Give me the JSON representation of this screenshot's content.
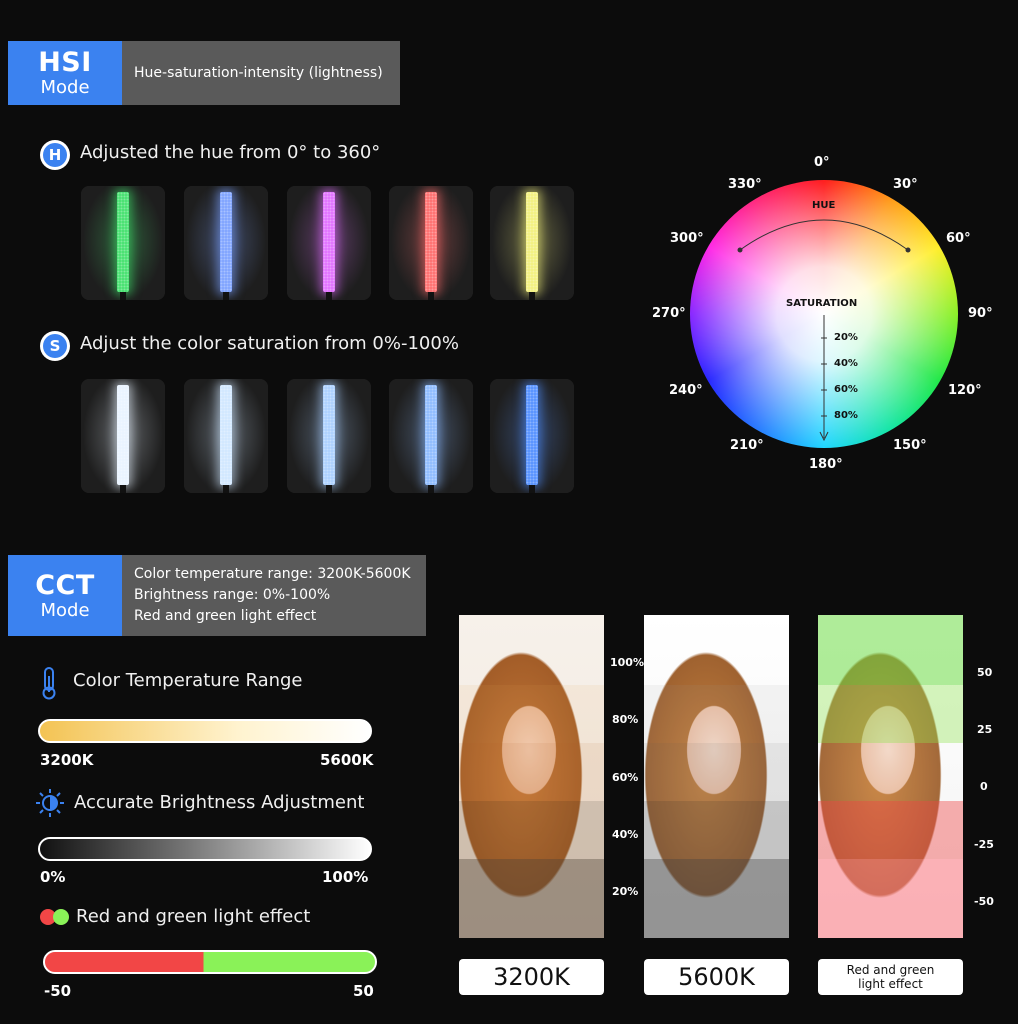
{
  "hsi": {
    "mode_title": "HSI",
    "mode_sub": "Mode",
    "description": "Hue-saturation-intensity (lightness)",
    "hue_letter": "H",
    "hue_heading": "Adjusted the hue from 0° to 360°",
    "hue_tiles": [
      "#3fe06a",
      "#7aa0ff",
      "#e06cff",
      "#ff6a6a",
      "#f2f07a"
    ],
    "sat_letter": "S",
    "sat_heading": "Adjust the color saturation from 0%-100%",
    "sat_tiles": [
      "#e8f3ff",
      "#cfe6ff",
      "#a9cfff",
      "#8ab9ff",
      "#4f8dff"
    ]
  },
  "wheel": {
    "hue_label": "HUE",
    "saturation_label": "SATURATION",
    "angles": [
      "0°",
      "30°",
      "60°",
      "90°",
      "120°",
      "150°",
      "180°",
      "210°",
      "240°",
      "270°",
      "300°",
      "330°"
    ],
    "saturation_ticks": [
      "20%",
      "40%",
      "60%",
      "80%"
    ]
  },
  "cct": {
    "mode_title": "CCT",
    "mode_sub": "Mode",
    "desc_lines": [
      "Color temperature range: 3200K-5600K",
      "Brightness range: 0%-100%",
      "Red and green light effect"
    ],
    "temp_heading": "Color Temperature Range",
    "temp_min": "3200K",
    "temp_max": "5600K",
    "bright_heading": "Accurate Brightness Adjustment",
    "bright_min": "0%",
    "bright_max": "100%",
    "rg_heading": "Red and green  light effect",
    "rg_min": "-50",
    "rg_max": "50"
  },
  "photos": {
    "brightness_scale": [
      "100%",
      "80%",
      "60%",
      "40%",
      "20%"
    ],
    "rg_scale": [
      "50",
      "25",
      "0",
      "-25",
      "-50"
    ],
    "captions": [
      "3200K",
      "5600K",
      "Red and green light effect"
    ]
  },
  "colors": {
    "accent": "#3b82f0",
    "red": "#f24646",
    "green": "#8af258"
  }
}
